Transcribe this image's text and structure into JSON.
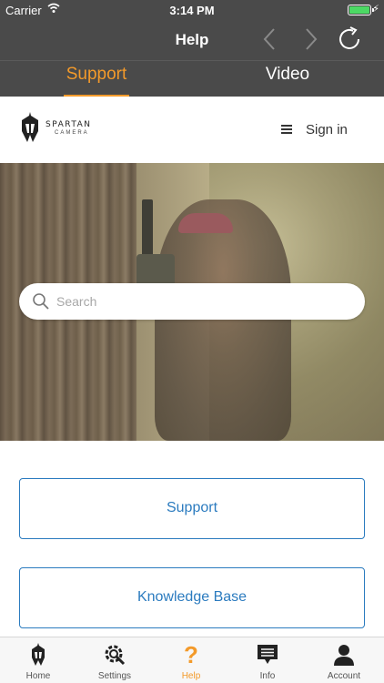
{
  "status_bar": {
    "carrier": "Carrier",
    "time": "3:14 PM",
    "battery": 1.0
  },
  "navbar": {
    "title": "Help"
  },
  "tabs": [
    {
      "label": "Support",
      "active": true
    },
    {
      "label": "Video",
      "active": false
    }
  ],
  "site": {
    "logo_text": "SPARTAN",
    "logo_sub": "CAMERA",
    "signin_label": "Sign in",
    "search_placeholder": "Search",
    "buttons": {
      "support": "Support",
      "knowledge_base": "Knowledge Base"
    }
  },
  "tabbar": [
    {
      "label": "Home",
      "icon": "spartan-helmet-icon",
      "active": false
    },
    {
      "label": "Settings",
      "icon": "gear-wrench-icon",
      "active": false
    },
    {
      "label": "Help",
      "icon": "question-mark-icon",
      "active": true
    },
    {
      "label": "Info",
      "icon": "message-icon",
      "active": false
    },
    {
      "label": "Account",
      "icon": "user-icon",
      "active": false
    }
  ],
  "colors": {
    "accent": "#f39a2a",
    "link": "#2b7bbf",
    "header_bg": "#4a4a4a"
  }
}
